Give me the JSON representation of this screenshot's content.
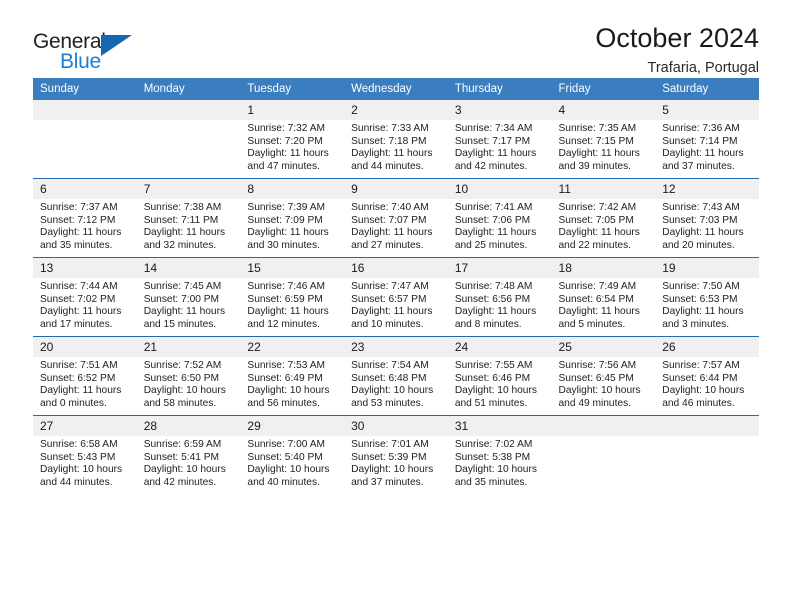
{
  "logo": {
    "word1": "General",
    "word2": "Blue",
    "triangle_color": "#1667b2",
    "blue_color": "#1b7fd4"
  },
  "header": {
    "title": "October 2024",
    "location": "Trafaria, Portugal"
  },
  "theme": {
    "header_blue": "#3a7ebf",
    "row_divider": "#1f6cb0",
    "daynum_band": "#f0f0f0"
  },
  "weekdays": [
    "Sunday",
    "Monday",
    "Tuesday",
    "Wednesday",
    "Thursday",
    "Friday",
    "Saturday"
  ],
  "weeks": [
    [
      {
        "day": "",
        "blank": true,
        "sunrise": "",
        "sunset": "",
        "daylight1": "",
        "daylight2": ""
      },
      {
        "day": "",
        "blank": true,
        "sunrise": "",
        "sunset": "",
        "daylight1": "",
        "daylight2": ""
      },
      {
        "day": "1",
        "sunrise": "Sunrise: 7:32 AM",
        "sunset": "Sunset: 7:20 PM",
        "daylight1": "Daylight: 11 hours",
        "daylight2": "and 47 minutes."
      },
      {
        "day": "2",
        "sunrise": "Sunrise: 7:33 AM",
        "sunset": "Sunset: 7:18 PM",
        "daylight1": "Daylight: 11 hours",
        "daylight2": "and 44 minutes."
      },
      {
        "day": "3",
        "sunrise": "Sunrise: 7:34 AM",
        "sunset": "Sunset: 7:17 PM",
        "daylight1": "Daylight: 11 hours",
        "daylight2": "and 42 minutes."
      },
      {
        "day": "4",
        "sunrise": "Sunrise: 7:35 AM",
        "sunset": "Sunset: 7:15 PM",
        "daylight1": "Daylight: 11 hours",
        "daylight2": "and 39 minutes."
      },
      {
        "day": "5",
        "sunrise": "Sunrise: 7:36 AM",
        "sunset": "Sunset: 7:14 PM",
        "daylight1": "Daylight: 11 hours",
        "daylight2": "and 37 minutes."
      }
    ],
    [
      {
        "day": "6",
        "sunrise": "Sunrise: 7:37 AM",
        "sunset": "Sunset: 7:12 PM",
        "daylight1": "Daylight: 11 hours",
        "daylight2": "and 35 minutes."
      },
      {
        "day": "7",
        "sunrise": "Sunrise: 7:38 AM",
        "sunset": "Sunset: 7:11 PM",
        "daylight1": "Daylight: 11 hours",
        "daylight2": "and 32 minutes."
      },
      {
        "day": "8",
        "sunrise": "Sunrise: 7:39 AM",
        "sunset": "Sunset: 7:09 PM",
        "daylight1": "Daylight: 11 hours",
        "daylight2": "and 30 minutes."
      },
      {
        "day": "9",
        "sunrise": "Sunrise: 7:40 AM",
        "sunset": "Sunset: 7:07 PM",
        "daylight1": "Daylight: 11 hours",
        "daylight2": "and 27 minutes."
      },
      {
        "day": "10",
        "sunrise": "Sunrise: 7:41 AM",
        "sunset": "Sunset: 7:06 PM",
        "daylight1": "Daylight: 11 hours",
        "daylight2": "and 25 minutes."
      },
      {
        "day": "11",
        "sunrise": "Sunrise: 7:42 AM",
        "sunset": "Sunset: 7:05 PM",
        "daylight1": "Daylight: 11 hours",
        "daylight2": "and 22 minutes."
      },
      {
        "day": "12",
        "sunrise": "Sunrise: 7:43 AM",
        "sunset": "Sunset: 7:03 PM",
        "daylight1": "Daylight: 11 hours",
        "daylight2": "and 20 minutes."
      }
    ],
    [
      {
        "day": "13",
        "sunrise": "Sunrise: 7:44 AM",
        "sunset": "Sunset: 7:02 PM",
        "daylight1": "Daylight: 11 hours",
        "daylight2": "and 17 minutes."
      },
      {
        "day": "14",
        "sunrise": "Sunrise: 7:45 AM",
        "sunset": "Sunset: 7:00 PM",
        "daylight1": "Daylight: 11 hours",
        "daylight2": "and 15 minutes."
      },
      {
        "day": "15",
        "sunrise": "Sunrise: 7:46 AM",
        "sunset": "Sunset: 6:59 PM",
        "daylight1": "Daylight: 11 hours",
        "daylight2": "and 12 minutes."
      },
      {
        "day": "16",
        "sunrise": "Sunrise: 7:47 AM",
        "sunset": "Sunset: 6:57 PM",
        "daylight1": "Daylight: 11 hours",
        "daylight2": "and 10 minutes."
      },
      {
        "day": "17",
        "sunrise": "Sunrise: 7:48 AM",
        "sunset": "Sunset: 6:56 PM",
        "daylight1": "Daylight: 11 hours",
        "daylight2": "and 8 minutes."
      },
      {
        "day": "18",
        "sunrise": "Sunrise: 7:49 AM",
        "sunset": "Sunset: 6:54 PM",
        "daylight1": "Daylight: 11 hours",
        "daylight2": "and 5 minutes."
      },
      {
        "day": "19",
        "sunrise": "Sunrise: 7:50 AM",
        "sunset": "Sunset: 6:53 PM",
        "daylight1": "Daylight: 11 hours",
        "daylight2": "and 3 minutes."
      }
    ],
    [
      {
        "day": "20",
        "sunrise": "Sunrise: 7:51 AM",
        "sunset": "Sunset: 6:52 PM",
        "daylight1": "Daylight: 11 hours",
        "daylight2": "and 0 minutes."
      },
      {
        "day": "21",
        "sunrise": "Sunrise: 7:52 AM",
        "sunset": "Sunset: 6:50 PM",
        "daylight1": "Daylight: 10 hours",
        "daylight2": "and 58 minutes."
      },
      {
        "day": "22",
        "sunrise": "Sunrise: 7:53 AM",
        "sunset": "Sunset: 6:49 PM",
        "daylight1": "Daylight: 10 hours",
        "daylight2": "and 56 minutes."
      },
      {
        "day": "23",
        "sunrise": "Sunrise: 7:54 AM",
        "sunset": "Sunset: 6:48 PM",
        "daylight1": "Daylight: 10 hours",
        "daylight2": "and 53 minutes."
      },
      {
        "day": "24",
        "sunrise": "Sunrise: 7:55 AM",
        "sunset": "Sunset: 6:46 PM",
        "daylight1": "Daylight: 10 hours",
        "daylight2": "and 51 minutes."
      },
      {
        "day": "25",
        "sunrise": "Sunrise: 7:56 AM",
        "sunset": "Sunset: 6:45 PM",
        "daylight1": "Daylight: 10 hours",
        "daylight2": "and 49 minutes."
      },
      {
        "day": "26",
        "sunrise": "Sunrise: 7:57 AM",
        "sunset": "Sunset: 6:44 PM",
        "daylight1": "Daylight: 10 hours",
        "daylight2": "and 46 minutes."
      }
    ],
    [
      {
        "day": "27",
        "sunrise": "Sunrise: 6:58 AM",
        "sunset": "Sunset: 5:43 PM",
        "daylight1": "Daylight: 10 hours",
        "daylight2": "and 44 minutes."
      },
      {
        "day": "28",
        "sunrise": "Sunrise: 6:59 AM",
        "sunset": "Sunset: 5:41 PM",
        "daylight1": "Daylight: 10 hours",
        "daylight2": "and 42 minutes."
      },
      {
        "day": "29",
        "sunrise": "Sunrise: 7:00 AM",
        "sunset": "Sunset: 5:40 PM",
        "daylight1": "Daylight: 10 hours",
        "daylight2": "and 40 minutes."
      },
      {
        "day": "30",
        "sunrise": "Sunrise: 7:01 AM",
        "sunset": "Sunset: 5:39 PM",
        "daylight1": "Daylight: 10 hours",
        "daylight2": "and 37 minutes."
      },
      {
        "day": "31",
        "sunrise": "Sunrise: 7:02 AM",
        "sunset": "Sunset: 5:38 PM",
        "daylight1": "Daylight: 10 hours",
        "daylight2": "and 35 minutes."
      },
      {
        "day": "",
        "blank": true,
        "sunrise": "",
        "sunset": "",
        "daylight1": "",
        "daylight2": ""
      },
      {
        "day": "",
        "blank": true,
        "sunrise": "",
        "sunset": "",
        "daylight1": "",
        "daylight2": ""
      }
    ]
  ]
}
